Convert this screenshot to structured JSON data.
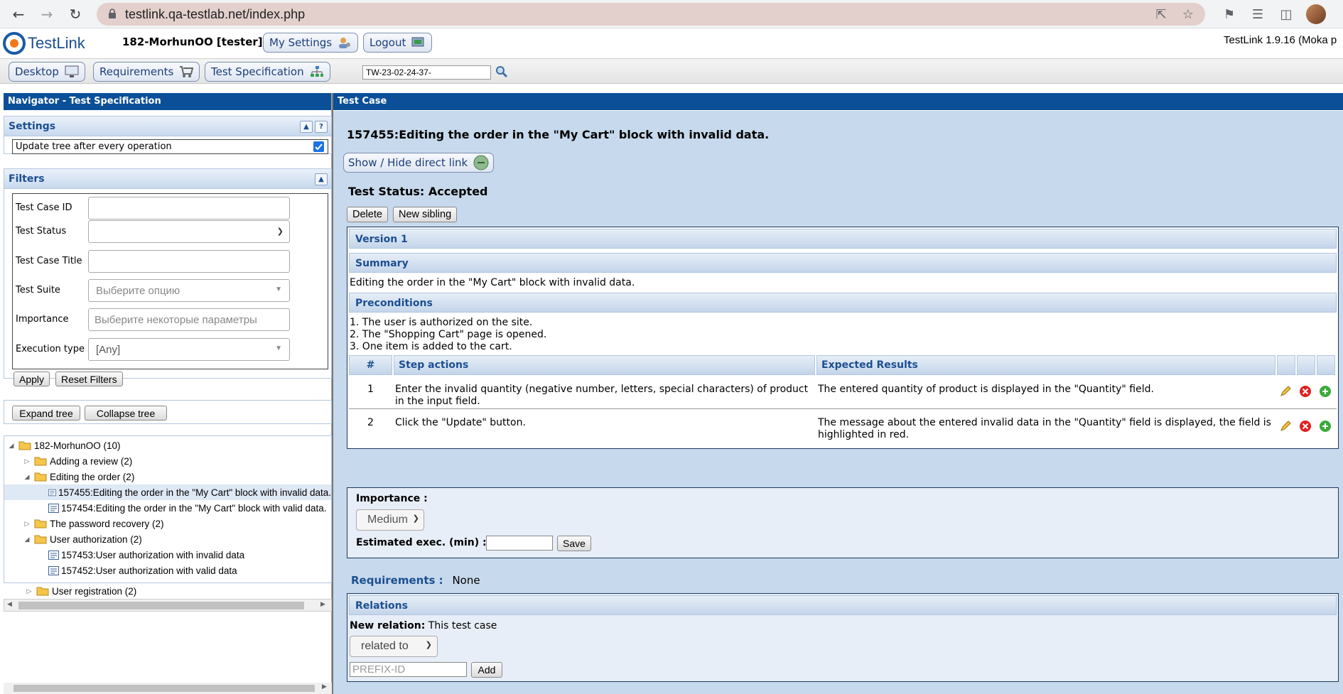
{
  "browser": {
    "url": "testlink.qa-testlab.net/index.php"
  },
  "header": {
    "logo_text": "TestLink",
    "user": "182-MorhunOO [tester]",
    "my_settings": "My Settings",
    "logout": "Logout",
    "version": "TestLink 1.9.16 (Moka p"
  },
  "menu": {
    "desktop": "Desktop",
    "requirements": "Requirements",
    "test_spec": "Test Specification",
    "search_value": "TW-23-02-24-37-"
  },
  "navigator": {
    "title": "Navigator - Test Specification",
    "settings_title": "Settings",
    "update_tree_label": "Update tree after every operation",
    "update_tree_checked": true,
    "filters_title": "Filters",
    "filters": [
      {
        "label": "Test Case ID",
        "value": ""
      },
      {
        "label": "Test Status",
        "value": ""
      },
      {
        "label": "Test Case Title",
        "value": ""
      },
      {
        "label": "Test Suite",
        "value": "Выберите опцию"
      },
      {
        "label": "Importance",
        "value": "Выберите некоторые параметры"
      },
      {
        "label": "Execution type",
        "value": "[Any]"
      }
    ],
    "apply": "Apply",
    "reset_filters": "Reset Filters",
    "expand_tree": "Expand tree",
    "collapse_tree": "Collapse tree",
    "tree": [
      {
        "label": "182-MorhunOO (10)",
        "kind": "folder",
        "expanded": true
      },
      {
        "label": "Adding a review (2)",
        "kind": "folder",
        "expanded": false
      },
      {
        "label": "Editing the order (2)",
        "kind": "folder",
        "expanded": true
      },
      {
        "label": "157455:Editing the order in the \"My Cart\" block with invalid data.",
        "kind": "case",
        "selected": true
      },
      {
        "label": "157454:Editing the order in the \"My Cart\" block with valid data.",
        "kind": "case"
      },
      {
        "label": "The password recovery (2)",
        "kind": "folder",
        "expanded": false
      },
      {
        "label": "User authorization (2)",
        "kind": "folder",
        "expanded": true
      },
      {
        "label": "157453:User authorization with invalid data",
        "kind": "case"
      },
      {
        "label": "157452:User authorization with valid data",
        "kind": "case"
      },
      {
        "label": "User registration (2)",
        "kind": "folder",
        "expanded": false
      }
    ]
  },
  "testcase": {
    "panel_title": "Test Case",
    "heading": "157455:Editing the order in the \"My Cart\" block with invalid data.",
    "show_hide_link": "Show / Hide direct link",
    "status": "Test Status: Accepted",
    "delete": "Delete",
    "new_sibling": "New sibling",
    "version": "Version 1",
    "summary_title": "Summary",
    "summary_text": "Editing the order in the \"My Cart\" block with invalid data.",
    "preconditions_title": "Preconditions",
    "preconditions": [
      "1. The user is authorized on the site.",
      "2. The \"Shopping Cart\" page is opened.",
      "3. One item is added to the cart."
    ],
    "steps_headers": {
      "num": "#",
      "actions": "Step actions",
      "expected": "Expected Results"
    },
    "steps": [
      {
        "num": "1",
        "action": "Enter the invalid quantity (negative number, letters, special characters) of product in the input field.",
        "expected": "The entered quantity of product is displayed in the \"Quantity\" field."
      },
      {
        "num": "2",
        "action": "Click the \"Update\" button.",
        "expected": "The message about the entered invalid data in the \"Quantity\" field is displayed, the field is highlighted in red."
      }
    ],
    "importance_label": "Importance :",
    "importance_value": "Medium",
    "estimated_label": "Estimated exec. (min) :",
    "estimated_value": "",
    "save": "Save",
    "requirements_label": "Requirements :",
    "requirements_value": "None",
    "relations_title": "Relations",
    "new_relation_label": "New relation:",
    "new_relation_text": "This test case",
    "relation_type": "related to",
    "prefix_placeholder": "PREFIX-ID",
    "add": "Add"
  }
}
